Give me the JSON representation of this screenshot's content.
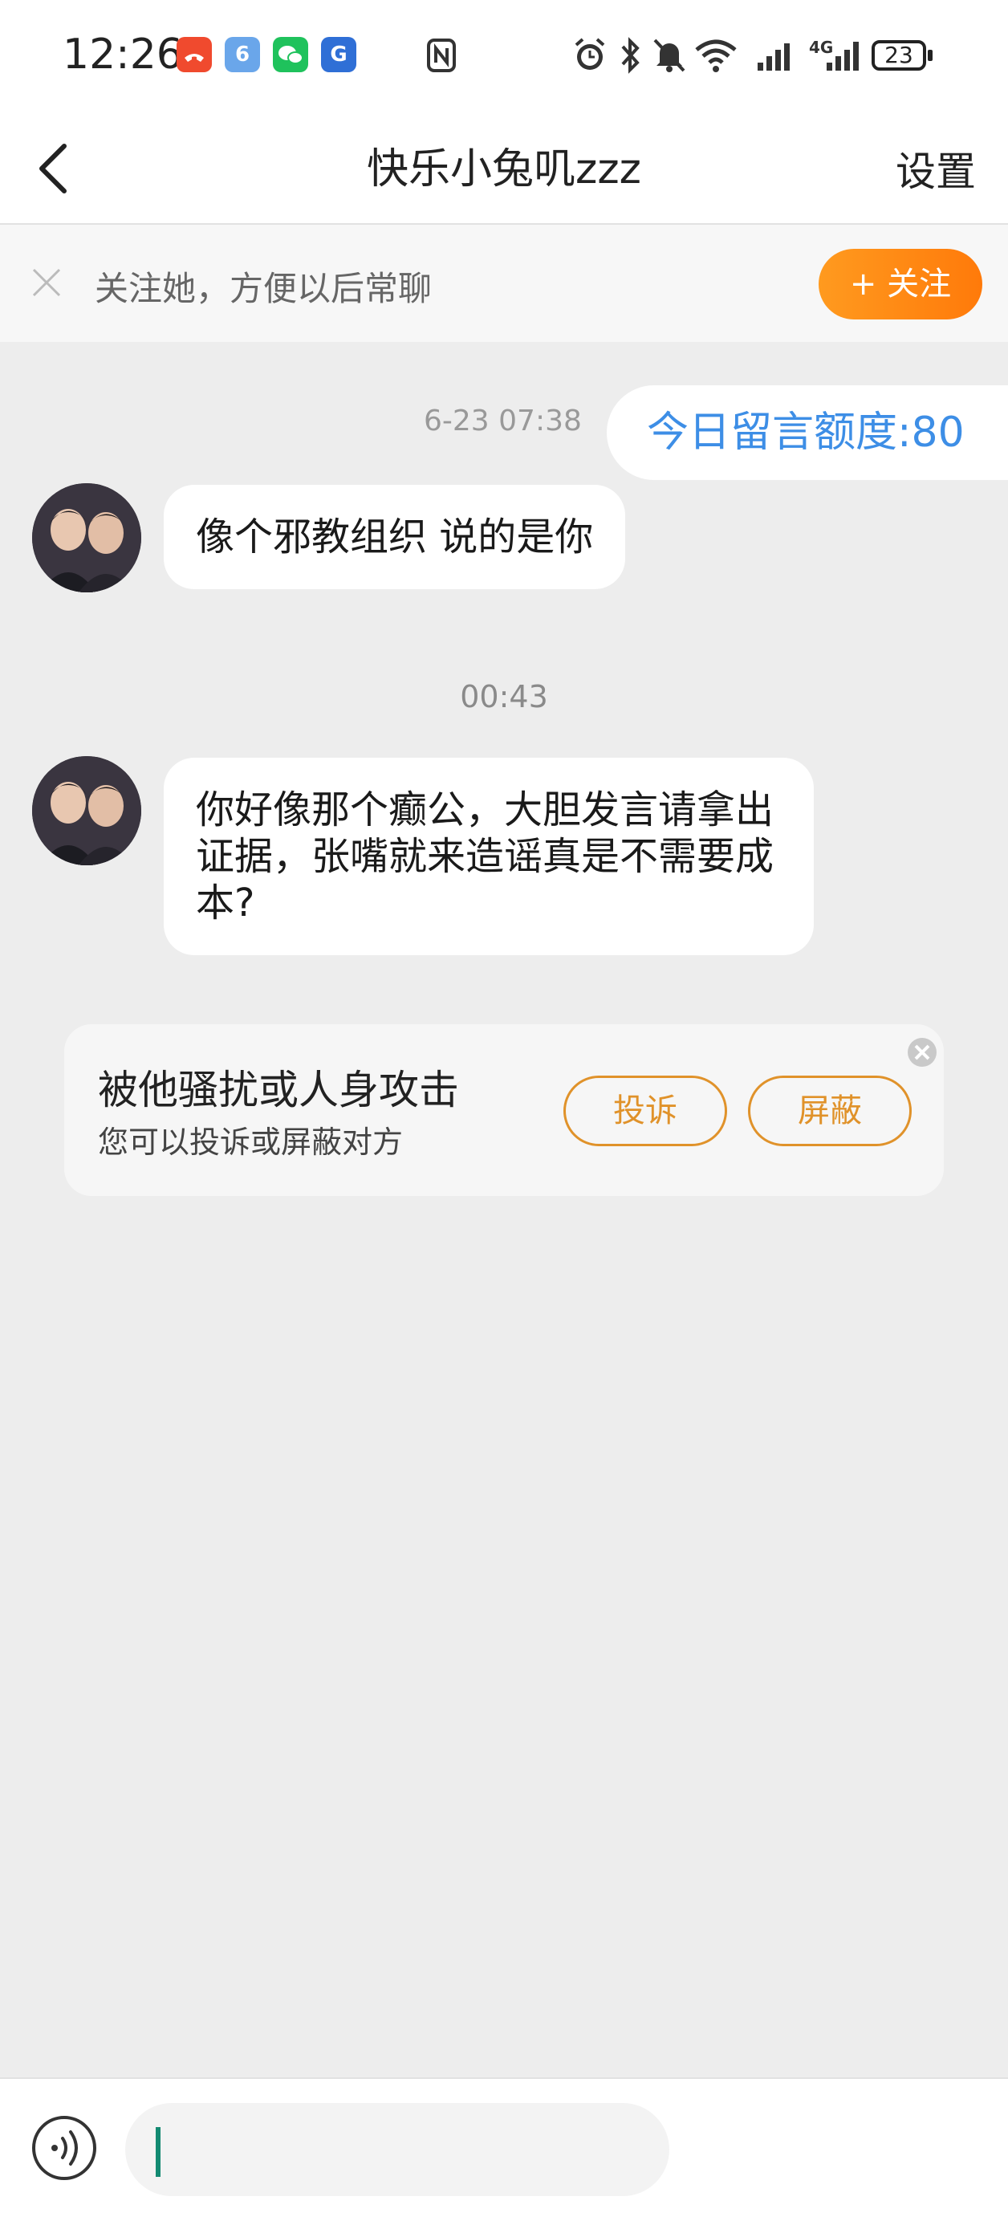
{
  "status_bar": {
    "time": "12:26",
    "notification_icons": [
      "missed-call-icon",
      "app-6-icon",
      "wechat-icon",
      "transit-app-icon"
    ],
    "nfc_icon": "nfc-icon",
    "right_icons": [
      "alarm-icon",
      "bluetooth-icon",
      "mute-bell-icon",
      "wifi-icon",
      "signal-icon",
      "signal-4g-icon"
    ],
    "battery": "23"
  },
  "navbar": {
    "title": "快乐小兔叽zzz",
    "settings_label": "设置"
  },
  "follow_bar": {
    "text": "关注她，方便以后常聊",
    "button_label": "+ 关注"
  },
  "messages": [
    {
      "time": "6-23 07:38",
      "type": "system",
      "text": "今日留言额度:80"
    },
    {
      "type": "incoming",
      "text": "像个邪教组织 说的是你"
    },
    {
      "time": "00:43"
    },
    {
      "type": "incoming",
      "text": "你好像那个癫公，大胆发言请拿出证据，张嘴就来造谣真是不需要成本?"
    }
  ],
  "report_card": {
    "title": "被他骚扰或人身攻击",
    "subtitle": "您可以投诉或屏蔽对方",
    "report_label": "投诉",
    "block_label": "屏蔽"
  },
  "input_bar": {
    "voice_icon": "voice-icon",
    "value": ""
  },
  "colors": {
    "accent_orange": "#ff8a12",
    "link_blue": "#3d8ee6",
    "background": "#ededed"
  }
}
